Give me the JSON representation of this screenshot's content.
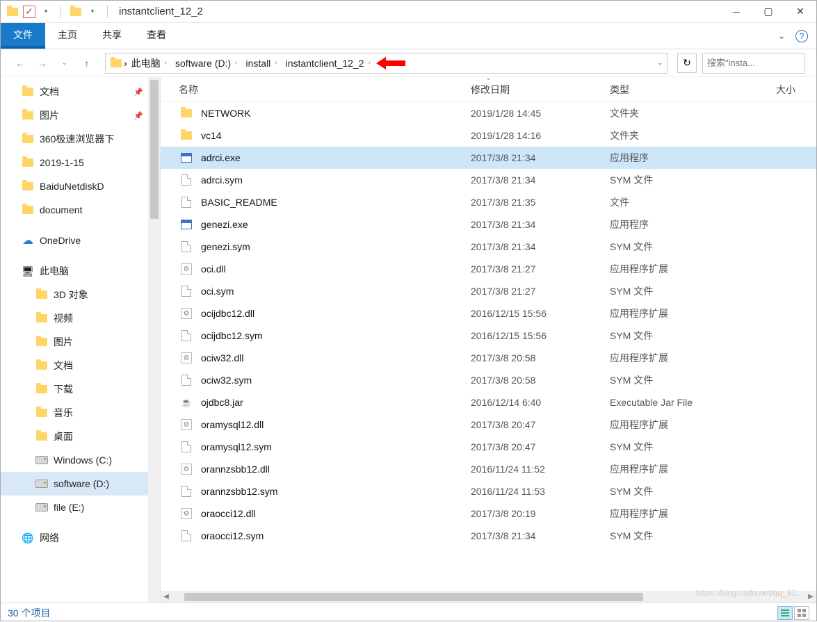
{
  "window": {
    "title": "instantclient_12_2",
    "tabs": {
      "file": "文件",
      "home": "主页",
      "share": "共享",
      "view": "查看"
    }
  },
  "breadcrumb": [
    "此电脑",
    "software (D:)",
    "install",
    "instantclient_12_2"
  ],
  "search": {
    "placeholder": "搜索\"insta..."
  },
  "columns": {
    "name": "名称",
    "date": "修改日期",
    "type": "类型",
    "size": "大小"
  },
  "tree": [
    {
      "label": "文档",
      "icon": "folder",
      "lv": 1,
      "pinned": true
    },
    {
      "label": "图片",
      "icon": "folder",
      "lv": 1,
      "pinned": true
    },
    {
      "label": "360极速浏览器下",
      "icon": "folder",
      "lv": 1
    },
    {
      "label": "2019-1-15",
      "icon": "folder",
      "lv": 1
    },
    {
      "label": "BaiduNetdiskD",
      "icon": "folder",
      "lv": 1
    },
    {
      "label": "document",
      "icon": "folder",
      "lv": 1
    },
    {
      "label": "",
      "icon": "",
      "lv": 0
    },
    {
      "label": "OneDrive",
      "icon": "cloud",
      "lv": 0
    },
    {
      "label": "",
      "icon": "",
      "lv": 0
    },
    {
      "label": "此电脑",
      "icon": "pc",
      "lv": 0
    },
    {
      "label": "3D 对象",
      "icon": "folder",
      "lv": 2
    },
    {
      "label": "视频",
      "icon": "folder",
      "lv": 2
    },
    {
      "label": "图片",
      "icon": "folder",
      "lv": 2
    },
    {
      "label": "文档",
      "icon": "folder",
      "lv": 2
    },
    {
      "label": "下载",
      "icon": "folder",
      "lv": 2
    },
    {
      "label": "音乐",
      "icon": "folder",
      "lv": 2
    },
    {
      "label": "桌面",
      "icon": "folder",
      "lv": 2
    },
    {
      "label": "Windows (C:)",
      "icon": "drive",
      "lv": 2
    },
    {
      "label": "software (D:)",
      "icon": "drive",
      "lv": 2,
      "selected": true
    },
    {
      "label": "file (E:)",
      "icon": "drive",
      "lv": 2
    },
    {
      "label": "",
      "icon": "",
      "lv": 0
    },
    {
      "label": "网络",
      "icon": "net",
      "lv": 0
    }
  ],
  "files": [
    {
      "name": "NETWORK",
      "date": "2019/1/28 14:45",
      "type": "文件夹",
      "icon": "folder"
    },
    {
      "name": "vc14",
      "date": "2019/1/28 14:16",
      "type": "文件夹",
      "icon": "folder"
    },
    {
      "name": "adrci.exe",
      "date": "2017/3/8 21:34",
      "type": "应用程序",
      "icon": "exe",
      "selected": true
    },
    {
      "name": "adrci.sym",
      "date": "2017/3/8 21:34",
      "type": "SYM 文件",
      "icon": "file"
    },
    {
      "name": "BASIC_README",
      "date": "2017/3/8 21:35",
      "type": "文件",
      "icon": "file"
    },
    {
      "name": "genezi.exe",
      "date": "2017/3/8 21:34",
      "type": "应用程序",
      "icon": "exe"
    },
    {
      "name": "genezi.sym",
      "date": "2017/3/8 21:34",
      "type": "SYM 文件",
      "icon": "file"
    },
    {
      "name": "oci.dll",
      "date": "2017/3/8 21:27",
      "type": "应用程序扩展",
      "icon": "dll"
    },
    {
      "name": "oci.sym",
      "date": "2017/3/8 21:27",
      "type": "SYM 文件",
      "icon": "file"
    },
    {
      "name": "ocijdbc12.dll",
      "date": "2016/12/15 15:56",
      "type": "应用程序扩展",
      "icon": "dll"
    },
    {
      "name": "ocijdbc12.sym",
      "date": "2016/12/15 15:56",
      "type": "SYM 文件",
      "icon": "file"
    },
    {
      "name": "ociw32.dll",
      "date": "2017/3/8 20:58",
      "type": "应用程序扩展",
      "icon": "dll"
    },
    {
      "name": "ociw32.sym",
      "date": "2017/3/8 20:58",
      "type": "SYM 文件",
      "icon": "file"
    },
    {
      "name": "ojdbc8.jar",
      "date": "2016/12/14 6:40",
      "type": "Executable Jar File",
      "icon": "jar"
    },
    {
      "name": "oramysql12.dll",
      "date": "2017/3/8 20:47",
      "type": "应用程序扩展",
      "icon": "dll"
    },
    {
      "name": "oramysql12.sym",
      "date": "2017/3/8 20:47",
      "type": "SYM 文件",
      "icon": "file"
    },
    {
      "name": "orannzsbb12.dll",
      "date": "2016/11/24 11:52",
      "type": "应用程序扩展",
      "icon": "dll"
    },
    {
      "name": "orannzsbb12.sym",
      "date": "2016/11/24 11:53",
      "type": "SYM 文件",
      "icon": "file"
    },
    {
      "name": "oraocci12.dll",
      "date": "2017/3/8 20:19",
      "type": "应用程序扩展",
      "icon": "dll"
    },
    {
      "name": "oraocci12.sym",
      "date": "2017/3/8 21:34",
      "type": "SYM 文件",
      "icon": "file"
    }
  ],
  "status": {
    "count": "30 个项目"
  },
  "watermark": "https://blog.csdn.net/qq_32..."
}
